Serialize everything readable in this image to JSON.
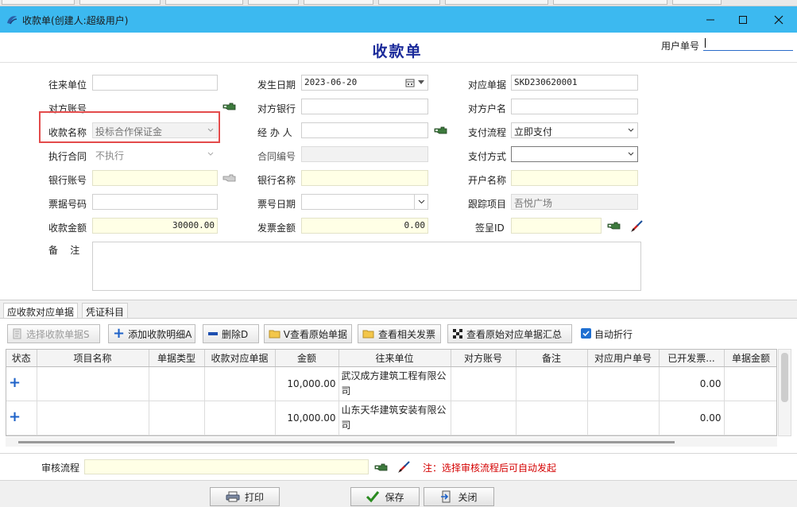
{
  "window": {
    "title": "收款单(创建人:超级用户)",
    "doc_title": "收款单"
  },
  "header": {
    "user_no_label": "用户单号",
    "user_no_value": ""
  },
  "form": {
    "counterparty_label": "往来单位",
    "counterparty_value": "",
    "date_label": "发生日期",
    "date_value": "2023-06-20",
    "ref_doc_label": "对应单据",
    "ref_doc_value": "SKD230620001",
    "their_account_label": "对方账号",
    "their_account_value": "",
    "their_bank_label": "对方银行",
    "their_bank_value": "",
    "their_name_label": "对方户名",
    "their_name_value": "",
    "receipt_name_label": "收款名称",
    "receipt_name_value": "投标合作保证金",
    "handler_label": "经 办 人",
    "handler_value": "",
    "pay_flow_label": "支付流程",
    "pay_flow_value": "立即支付",
    "contract_label": "执行合同",
    "contract_value": "不执行",
    "contract_no_label": "合同编号",
    "contract_no_value": "",
    "pay_method_label": "支付方式",
    "pay_method_value": "",
    "bank_account_label": "银行账号",
    "bank_account_value": "",
    "bank_name_label": "银行名称",
    "bank_name_value": "",
    "open_name_label": "开户名称",
    "open_name_value": "",
    "bill_no_label": "票据号码",
    "bill_no_value": "",
    "bill_date_label": "票号日期",
    "bill_date_value": "",
    "track_item_label": "跟踪项目",
    "track_item_value": "吾悦广场",
    "amount_label": "收款金额",
    "amount_value": "30000.00",
    "invoice_amount_label": "发票金额",
    "invoice_amount_value": "0.00",
    "sign_id_label": "签呈ID",
    "sign_id_value": "",
    "remarks_label": "备    注",
    "remarks_value": ""
  },
  "tabs": [
    {
      "label": "应收款对应单据"
    },
    {
      "label": "凭证科目"
    }
  ],
  "toolbar": {
    "select_label": "选择收款单据S",
    "add_label": "添加收款明细A",
    "delete_label": "删除D",
    "view_original_label": "V查看原始单据",
    "view_invoice_label": "查看相关发票",
    "view_summary_label": "查看原始对应单据汇总",
    "auto_discount_label": "自动折行"
  },
  "grid": {
    "columns": [
      "状态",
      "项目名称",
      "单据类型",
      "收款对应单据",
      "金额",
      "往来单位",
      "对方账号",
      "备注",
      "对应用户单号",
      "已开发票...",
      "单据金额"
    ],
    "rows": [
      {
        "amount": "10,000.00",
        "unit": "武汉成方建筑工程有限公司",
        "invoiced": "0.00"
      },
      {
        "amount": "10,000.00",
        "unit": "山东天华建筑安装有限公司",
        "invoiced": "0.00"
      }
    ]
  },
  "audit": {
    "label": "审核流程",
    "value": "",
    "note": "注：选择审核流程后可自动发起"
  },
  "buttons": {
    "print": "打印",
    "save": "保存",
    "close": "关闭"
  },
  "colors": {
    "titlebar": "#3cb9f0",
    "doc_title": "#1a2a9a",
    "highlight": "#e34b4b",
    "note": "#d40000",
    "yellow_field": "#ffffe6"
  }
}
